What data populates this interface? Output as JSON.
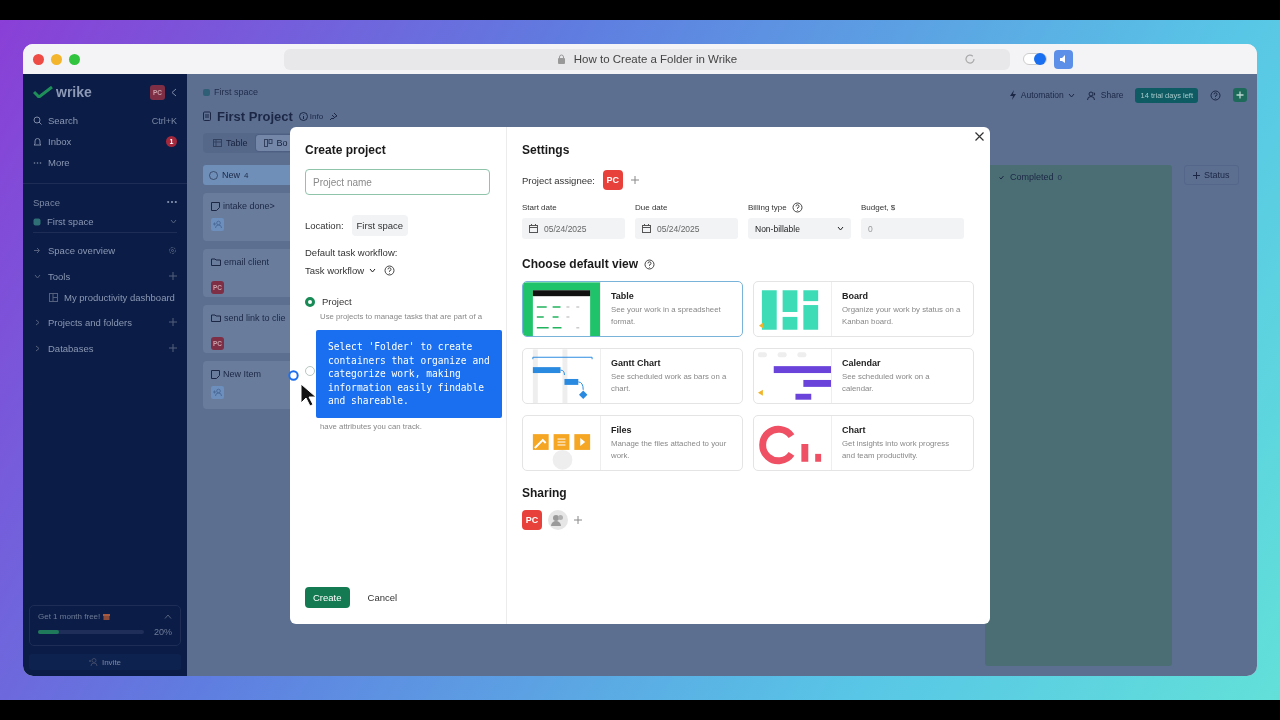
{
  "browser": {
    "title": "How to Create a Folder in Wrike",
    "toggle_on": true
  },
  "sidebar": {
    "logo": "wrike",
    "avatar": "PC",
    "nav": [
      {
        "kind": "search",
        "label": "Search",
        "shortcut": "Ctrl+K"
      },
      {
        "kind": "inbox",
        "label": "Inbox",
        "badge": "1"
      },
      {
        "kind": "more",
        "label": "More"
      }
    ],
    "space_heading": "Space",
    "space_select": "First space",
    "items": [
      {
        "kind": "overview",
        "label": "Space overview"
      },
      {
        "kind": "group",
        "label": "Tools",
        "expanded": true,
        "children": [
          {
            "label": "My productivity dashboard"
          }
        ]
      },
      {
        "kind": "group",
        "label": "Projects and folders",
        "expanded": false
      },
      {
        "kind": "group",
        "label": "Databases",
        "expanded": false
      }
    ],
    "promo": {
      "title": "Get 1 month free!",
      "level": 0.2,
      "reading": "20%"
    },
    "invite": "Invite"
  },
  "header": {
    "breadcrumb": "First space",
    "title": "First Project",
    "info": "Info",
    "views": [
      {
        "label": "Table",
        "selected": false
      },
      {
        "label": "Bo",
        "selected": true
      }
    ],
    "automation": "Automation",
    "share": "Share",
    "trial": "14 trial days left"
  },
  "board": {
    "columns": [
      {
        "name": "New",
        "count": "4",
        "color": "#6f8fb8",
        "cards": [
          {
            "kind": "task",
            "title": "intake done>"
          },
          {
            "kind": "folder",
            "title": "email client",
            "avatar": "PC"
          },
          {
            "kind": "folder",
            "title": "send link to clie",
            "avatar": "PC"
          },
          {
            "kind": "task",
            "title": "New Item"
          }
        ]
      },
      {
        "name": "Completed",
        "count": "0",
        "color": "#4b6e74"
      }
    ],
    "add_status": "Status"
  },
  "modal": {
    "title": "Create project",
    "name_placeholder": "Project name",
    "location_label": "Location:",
    "location": "First space",
    "workflow_label": "Default task workflow:",
    "workflow": "Task workflow",
    "types": [
      {
        "label": "Project",
        "selected": true,
        "description": "Use projects to manage tasks that are part of a"
      },
      {
        "selected": false,
        "description": "have attributes you can track."
      }
    ],
    "tooltip": "Select 'Folder' to create containers that organize and categorize work, making information easily findable and shareable.",
    "buttons": {
      "create": "Create",
      "cancel": "Cancel"
    },
    "settings": {
      "title": "Settings",
      "assignee_label": "Project assignee:",
      "assignee": "PC",
      "fields": [
        {
          "kind": "date",
          "label": "Start date",
          "value": "05/24/2025"
        },
        {
          "kind": "date",
          "label": "Due date",
          "value": "05/24/2025"
        },
        {
          "kind": "select",
          "label": "Billing type",
          "help": true,
          "value": "Non-billable"
        },
        {
          "kind": "number",
          "label": "Budget, $",
          "placeholder": "0"
        }
      ],
      "views_title": "Choose default view",
      "views": [
        {
          "kind": "table",
          "name": "Table",
          "description": "See your work in a spreadsheet format.",
          "selected": true
        },
        {
          "kind": "board",
          "name": "Board",
          "description": "Organize your work by status on a Kanban board.",
          "selected": false
        },
        {
          "kind": "gantt",
          "name": "Gantt Chart",
          "description": "See scheduled work as bars on a chart.",
          "selected": false
        },
        {
          "kind": "calendar",
          "name": "Calendar",
          "description": "See scheduled work on a calendar.",
          "selected": false
        },
        {
          "kind": "files",
          "name": "Files",
          "description": "Manage the files attached to your work.",
          "selected": false
        },
        {
          "kind": "chart",
          "name": "Chart",
          "description": "Get insights into work progress and team productivity.",
          "selected": false
        }
      ],
      "sharing_title": "Sharing",
      "sharing_avatar": "PC"
    }
  }
}
